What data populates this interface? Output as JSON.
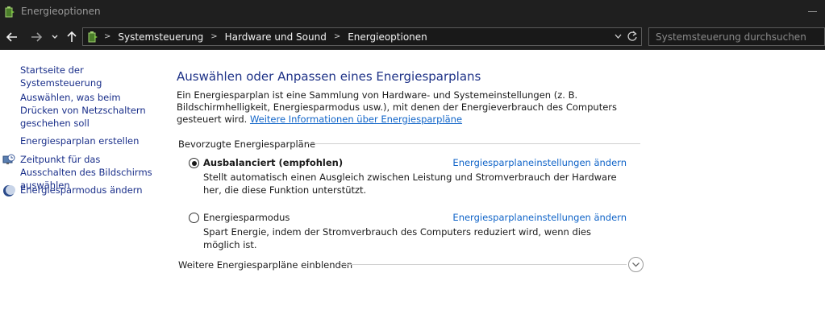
{
  "window": {
    "title": "Energieoptionen",
    "app_icon": "battery-power-icon"
  },
  "navigation": {
    "back_icon": "arrow-left-icon",
    "forward_icon": "arrow-right-icon",
    "recent_icon": "chevron-down-icon",
    "up_icon": "arrow-up-icon",
    "breadcrumb": [
      "Systemsteuerung",
      "Hardware und Sound",
      "Energieoptionen"
    ],
    "search_placeholder": "Systemsteuerung durchsuchen"
  },
  "sidebar": {
    "items": [
      {
        "label": "Startseite der Systemsteuerung"
      },
      {
        "label": "Auswählen, was beim Drücken von Netzschaltern geschehen soll"
      },
      {
        "label": "Energiesparplan erstellen"
      },
      {
        "label": "Zeitpunkt für das Ausschalten des Bildschirms auswählen",
        "icon": "monitor-clock-icon"
      },
      {
        "label": "Energiesparmodus ändern",
        "icon": "moon-icon"
      }
    ]
  },
  "main": {
    "heading": "Auswählen oder Anpassen eines Energiesparplans",
    "intro_text": "Ein Energiesparplan ist eine Sammlung von Hardware- und Systemeinstellungen (z. B. Bildschirmhelligkeit, Energiesparmodus usw.), mit denen der Energieverbrauch des Computers gesteuert wird. ",
    "intro_link": "Weitere Informationen über Energiesparpläne",
    "group_label": "Bevorzugte Energiesparpläne",
    "plans": [
      {
        "name": "Ausbalanciert (empfohlen)",
        "selected": true,
        "change_link": "Energiesparplaneinstellungen ändern",
        "description": "Stellt automatisch einen Ausgleich zwischen Leistung und Stromverbrauch der Hardware her, die diese Funktion unterstützt."
      },
      {
        "name": "Energiesparmodus",
        "selected": false,
        "change_link": "Energiesparplaneinstellungen ändern",
        "description": "Spart Energie, indem der Stromverbrauch des Computers reduziert wird, wenn dies möglich ist."
      }
    ],
    "more_plans_label": "Weitere Energiesparpläne einblenden",
    "more_plans_icon": "chevron-down-circle-icon"
  },
  "colors": {
    "titlebar_bg": "#1f1f1f",
    "heading": "#1e3287",
    "link": "#1064c8",
    "sidebar_link": "#1a2f8a"
  }
}
